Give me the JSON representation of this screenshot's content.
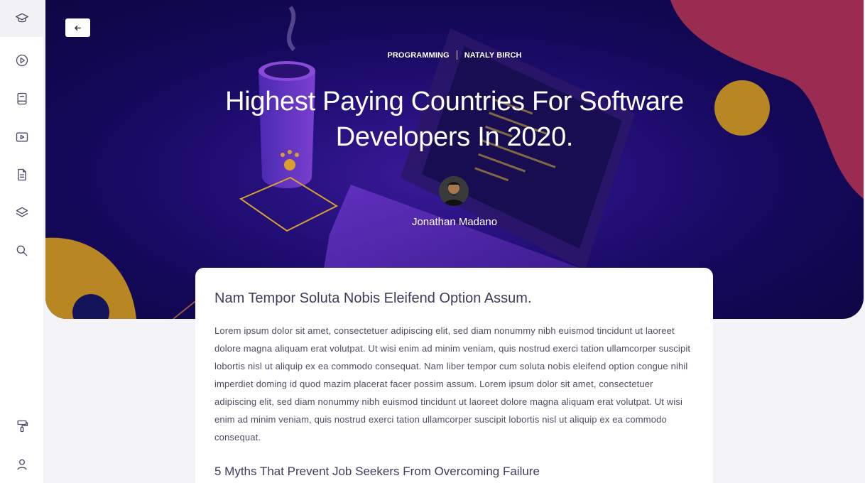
{
  "sidebar": {
    "items": [
      {
        "name": "graduation-cap-icon",
        "active": true
      },
      {
        "name": "play-circle-icon",
        "active": false
      },
      {
        "name": "book-icon",
        "active": false
      },
      {
        "name": "video-icon",
        "active": false
      },
      {
        "name": "document-icon",
        "active": false
      },
      {
        "name": "layers-icon",
        "active": false
      },
      {
        "name": "search-icon",
        "active": false
      },
      {
        "name": "paint-roller-icon",
        "active": false
      },
      {
        "name": "user-icon",
        "active": false
      }
    ]
  },
  "header": {
    "back_icon": "arrow-left-icon",
    "category": "PROGRAMMING",
    "author_tag": "NATALY BIRCH",
    "title": "Highest Paying Countries For Software Developers In 2020.",
    "author_name": "Jonathan Madano"
  },
  "colors": {
    "hero_bg": "#14085a",
    "blob_pink": "#9a2c52",
    "blob_gold": "#b88622",
    "page_bg": "#f3f3f8"
  },
  "article": {
    "heading": "Nam Tempor Soluta Nobis Eleifend Option Assum.",
    "paragraph": "Lorem ipsum dolor sit amet, consectetuer adipiscing elit, sed diam nonummy nibh euismod tincidunt ut laoreet dolore magna aliquam erat volutpat. Ut wisi enim ad minim veniam, quis nostrud exerci tation ullamcorper suscipit lobortis nisl ut aliquip ex ea commodo consequat. Nam liber tempor cum soluta nobis eleifend option congue nihil imperdiet doming id quod mazim placerat facer possim assum. Lorem ipsum dolor sit amet, consectetuer adipiscing elit, sed diam nonummy nibh euismod tincidunt ut laoreet dolore magna aliquam erat volutpat. Ut wisi enim ad minim veniam, quis nostrud exerci tation ullamcorper suscipit lobortis nisl ut aliquip ex ea commodo consequat.",
    "subheading": "5 Myths That Prevent Job Seekers From Overcoming Failure"
  }
}
